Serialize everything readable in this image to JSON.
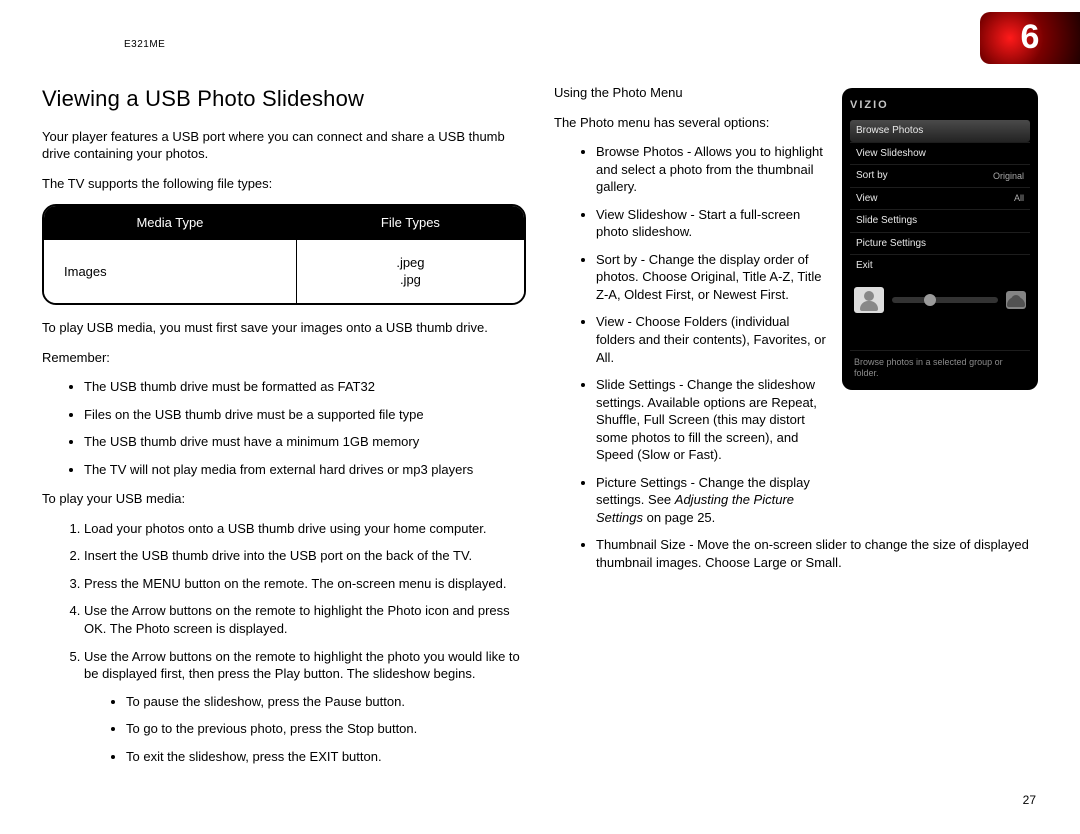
{
  "header": {
    "model": "E321ME",
    "chapter_number": "6"
  },
  "page_number": "27",
  "left": {
    "title": "Viewing a USB Photo Slideshow",
    "intro": "Your player features a USB port where you can connect and share a USB thumb drive containing your photos.",
    "supports_line": "The TV supports the following ﬁle types:",
    "table": {
      "head_media": "Media Type",
      "head_file": "File Types",
      "row_media": "Images",
      "row_file_1": ".jpeg",
      "row_file_2": ".jpg"
    },
    "must_save": "To play USB media, you must ﬁrst save your images onto a USB thumb drive.",
    "remember_label": "Remember:",
    "remember": [
      "The USB thumb drive must be formatted as FAT32",
      "Files on the USB thumb drive must be a supported file type",
      "The USB thumb drive must have a minimum 1GB memory",
      "The TV will not play media from external hard drives or mp3 players"
    ],
    "toplay_label": "To play your USB media:",
    "steps": [
      "Load your photos onto a USB thumb drive using your home computer.",
      "Insert the USB thumb drive into the USB port on the back of the TV.",
      "Press the MENU button on the remote. The on-screen menu is displayed.",
      "Use the Arrow buttons on the remote to highlight the Photo icon and press OK. The Photo screen is displayed.",
      "Use the Arrow buttons on the remote to highlight the photo you would like to be displayed ﬁrst, then press the Play button. The slideshow begins."
    ],
    "sub_controls": [
      "To pause the slideshow, press the Pause button.",
      "To go to the previous photo, press the Stop button.",
      "To exit the slideshow, press the EXIT button."
    ]
  },
  "right": {
    "using_label": "Using the Photo Menu",
    "intro": "The Photo menu has several options:",
    "bullets": [
      "Browse Photos - Allows you to highlight and select a photo from the thumbnail gallery.",
      "View Slideshow - Start a full-screen photo slideshow.",
      "Sort by - Change the display order of photos. Choose Original, Title A-Z, Title Z-A, Oldest First, or Newest First.",
      "View - Choose Folders (individual folders and their contents), Favorites, or All.",
      "Slide Settings - Change the slideshow settings. Available options are Repeat, Shufﬂe, Full Screen (this may distort some photos to fill the screen), and Speed (Slow or Fast)."
    ],
    "picture_settings_lead": "Picture Settings - Change the display settings. See ",
    "picture_settings_italic": "Adjusting the Picture Settings",
    "picture_settings_trail": " on page 25.",
    "thumbnail_bullet": "Thumbnail Size - Move the on-screen slider to change the size of displayed thumbnail images. Choose Large or Small."
  },
  "photo_menu": {
    "brand": "VIZIO",
    "rows": [
      {
        "label": "Browse Photos",
        "value": ""
      },
      {
        "label": "View Slideshow",
        "value": ""
      },
      {
        "label": "Sort by",
        "value": "Original"
      },
      {
        "label": "View",
        "value": "All"
      },
      {
        "label": "Slide Settings",
        "value": ""
      },
      {
        "label": "Picture Settings",
        "value": ""
      },
      {
        "label": "Exit",
        "value": ""
      }
    ],
    "help_text": "Browse photos in a selected group or folder."
  }
}
